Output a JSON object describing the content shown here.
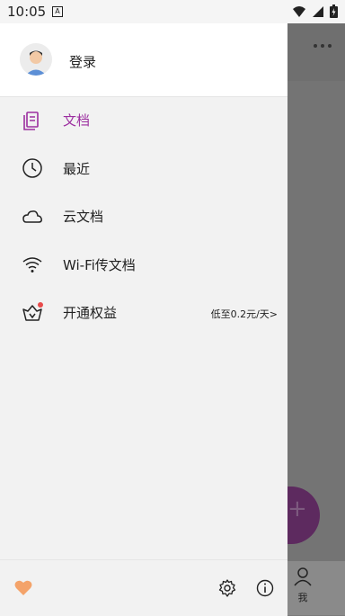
{
  "status": {
    "time": "10:05",
    "a_badge": "A"
  },
  "header": {
    "login_label": "登录"
  },
  "menu": {
    "items": [
      {
        "label": "文档",
        "icon": "document-icon",
        "active": true
      },
      {
        "label": "最近",
        "icon": "clock-icon"
      },
      {
        "label": "云文档",
        "icon": "cloud-icon"
      },
      {
        "label": "Wi-Fi传文档",
        "icon": "wifi-icon"
      },
      {
        "label": "开通权益",
        "icon": "vip-basket-icon",
        "extra": "低至0.2元/天>"
      }
    ]
  },
  "bottom_nav": {
    "me_label": "我"
  },
  "colors": {
    "accent": "#9c2fa0",
    "heart": "#f4a36a",
    "fab": "#5d2a5f"
  }
}
